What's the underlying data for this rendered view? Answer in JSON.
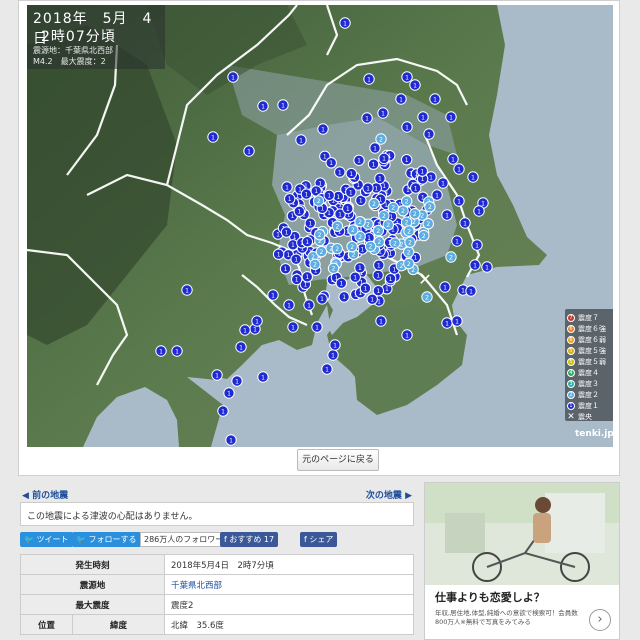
{
  "map": {
    "date": "2018年　5月　4日",
    "time": "2時07分頃",
    "epicenter_line": "震源地：千葉県北西部",
    "magnitude_line": "M4.2　最大震度：2",
    "credit": "tenki.jp",
    "epicenter_marker": "✕",
    "station_marker_label": "1",
    "strong_marker_label": "2",
    "legend": [
      {
        "label": "震度７",
        "color": "#c0392b",
        "glyph": "7"
      },
      {
        "label": "震度６強",
        "color": "#e67e22",
        "glyph": "6"
      },
      {
        "label": "震度６弱",
        "color": "#f39c12",
        "glyph": "6"
      },
      {
        "label": "震度５強",
        "color": "#d4ac0d",
        "glyph": "5"
      },
      {
        "label": "震度５弱",
        "color": "#c8c000",
        "glyph": "5"
      },
      {
        "label": "震度４",
        "color": "#27ae60",
        "glyph": "4"
      },
      {
        "label": "震度３",
        "color": "#20b2aa",
        "glyph": "3"
      },
      {
        "label": "震度２",
        "color": "#5dade2",
        "glyph": "2"
      },
      {
        "label": "震度１",
        "color": "#1f2bd0",
        "glyph": "1"
      },
      {
        "label": "震央",
        "color": "#ffffff",
        "glyph": "✕"
      }
    ],
    "colors": {
      "sea": "#a9bbc9",
      "land": "#55704a",
      "mountain": "#3e5936",
      "urban": "#9fb3b8",
      "border": "#ffffff",
      "intensity1": "#1f2bd0",
      "intensity2": "#5dade2"
    }
  },
  "back_button": "元のページに戻る",
  "nav": {
    "prev": "前の地震",
    "next": "次の地震"
  },
  "tsunami_note": "この地震による津波の心配はありません。",
  "social": {
    "tweet": "ツイート",
    "follow": "フォローする",
    "follower_count": "286万人のフォロワー",
    "fb_like": "おすすめ 17",
    "fb_share": "シェア"
  },
  "details": {
    "occurred_label": "発生時刻",
    "occurred_value": "2018年5月4日　2時7分頃",
    "epicenter_label": "震源地",
    "epicenter_value": "千葉県北西部",
    "max_intensity_label": "最大震度",
    "max_intensity_value": "震度2",
    "position_label": "位置",
    "latitude_label": "緯度",
    "latitude_value": "北緯　35.6度"
  },
  "ad": {
    "headline": "仕事よりも恋愛しよ？",
    "subtext": "年収,居住地,体型,純婚への意欲で検索可！会員数800万人※無料で写真をみてみる",
    "arrow": "›"
  }
}
